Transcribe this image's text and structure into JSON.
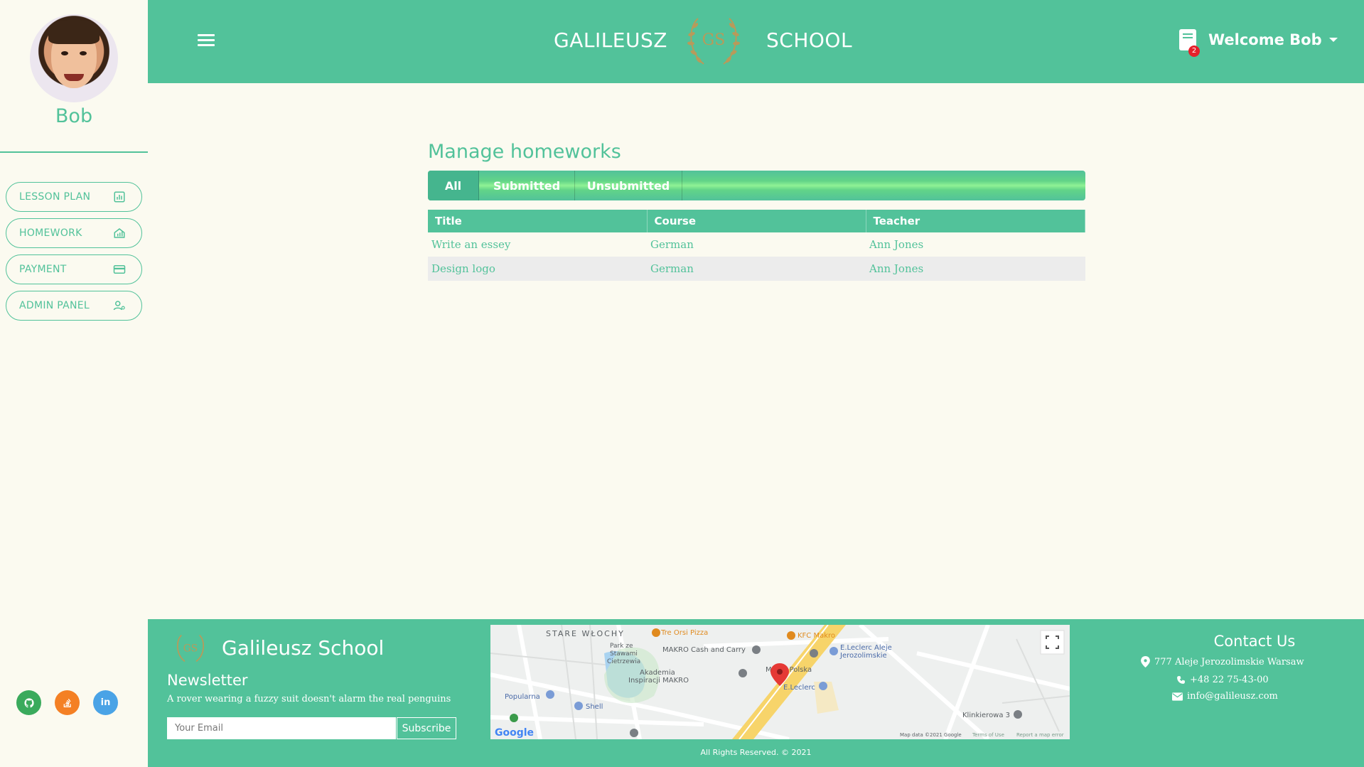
{
  "user": {
    "name": "Bob"
  },
  "sidebar": {
    "items": [
      {
        "label": "LESSON PLAN",
        "icon": "chart-icon"
      },
      {
        "label": "HOMEWORK",
        "icon": "house-chart-icon"
      },
      {
        "label": "PAYMENT",
        "icon": "credit-card-icon"
      },
      {
        "label": "ADMIN PANEL",
        "icon": "user-gear-icon"
      }
    ],
    "social": [
      {
        "name": "github",
        "glyph": "⌬",
        "color": "#3aaa5c"
      },
      {
        "name": "stackoverflow",
        "glyph": "≡",
        "color": "#f48024"
      },
      {
        "name": "linkedin",
        "glyph": "in",
        "color": "#4aa3e6"
      }
    ]
  },
  "header": {
    "brand_left": "GALILEUSZ",
    "brand_right": "SCHOOL",
    "logo_text": "GS",
    "welcome": "Welcome Bob",
    "notification_count": "2",
    "colors": {
      "primary": "#52c29a",
      "gold": "#b89a5a",
      "badge": "#e5202a"
    }
  },
  "main": {
    "title": "Manage homeworks",
    "tabs": [
      {
        "label": "All",
        "active": true
      },
      {
        "label": "Submitted",
        "active": false
      },
      {
        "label": "Unsubmitted",
        "active": false
      }
    ],
    "table": {
      "headers": [
        "Title",
        "Course",
        "Teacher"
      ],
      "rows": [
        [
          "Write an essey",
          "German",
          "Ann Jones"
        ],
        [
          "Design logo",
          "German",
          "Ann Jones"
        ]
      ]
    }
  },
  "footer": {
    "brand": "Galileusz School",
    "logo_text": "GS",
    "newsletter_title": "Newsletter",
    "tagline": "A rover wearing a fuzzy suit doesn't alarm the real penguins",
    "email_placeholder": "Your Email",
    "subscribe_label": "Subscribe",
    "map": {
      "labels": {
        "stare": "STARE WŁOCHY",
        "tre_orsi": "Tre Orsi Pizza",
        "kfc": "KFC Makro",
        "park": "Park ze\nStawami\nCietrzewia",
        "makro": "MAKRO Cash and Carry",
        "leclerc_aleje": "E.Leclerc Aleje\nJerozolimskie",
        "akademia": "Akademia\nInspiracji MAKRO",
        "msoft": "M   soft Polska",
        "leclerc": "E.Leclerc",
        "popularna": "Popularna",
        "shell": "Shell",
        "klinkierowa": "Klinkierowa 3",
        "mapdata": "Map data ©2021 Google",
        "terms": "Terms of Use",
        "report": "Report a map error",
        "google": "Google"
      }
    },
    "contact": {
      "title": "Contact Us",
      "address": "777 Aleje Jerozolimskie Warsaw",
      "phone": "+48 22 75-43-00",
      "email": "info@galileusz.com"
    },
    "copyright": "All Rights Reserved. © 2021"
  }
}
